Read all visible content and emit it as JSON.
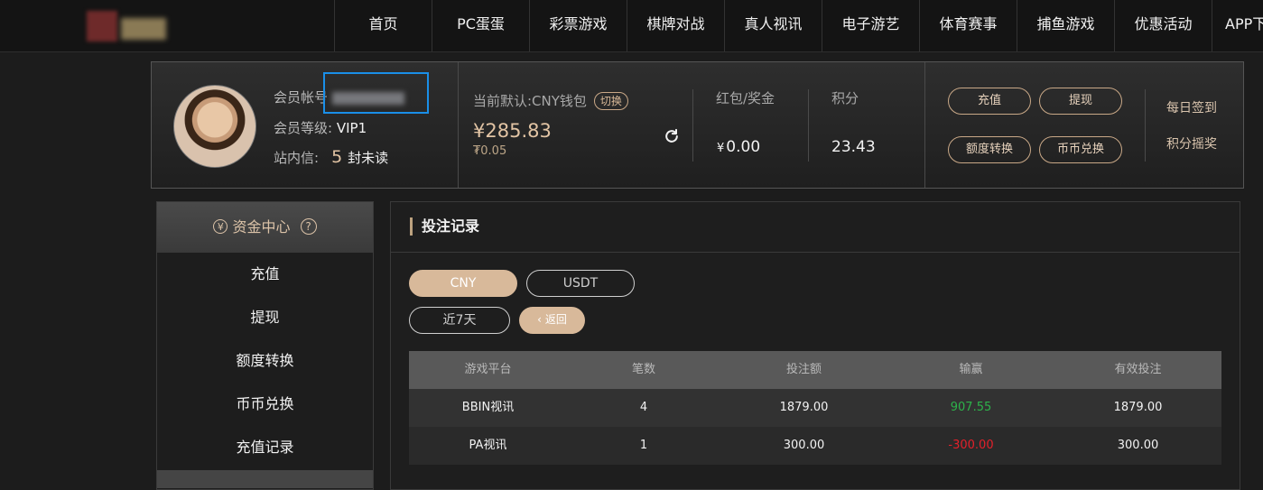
{
  "nav": {
    "items": [
      "首页",
      "PC蛋蛋",
      "彩票游戏",
      "棋牌对战",
      "真人视讯",
      "电子游艺",
      "体育赛事",
      "捕鱼游戏",
      "优惠活动",
      "APP下载"
    ]
  },
  "profile": {
    "account_label": "会员帐号",
    "level_label": "会员等级:",
    "level_value": "VIP1",
    "mail_label": "站内信:",
    "mail_count": "5",
    "mail_unread": "封未读",
    "wallet_label": "当前默认:CNY钱包",
    "switch_label": "切换",
    "balance": "¥285.83",
    "balance_sub": "₮0.05",
    "redpacket_label": "红包/奖金",
    "redpacket_currency": "¥",
    "redpacket_value": "0.00",
    "points_label": "积分",
    "points_value": "23.43",
    "btn_deposit": "充值",
    "btn_withdraw": "提现",
    "btn_transfer": "额度转换",
    "btn_exchange": "币币兑换",
    "daily_signin": "每日签到",
    "points_lottery": "积分摇奖"
  },
  "sidebar": {
    "title": "资金中心",
    "coin_glyph": "¥",
    "help_glyph": "?",
    "items": [
      "充值",
      "提现",
      "额度转换",
      "币币兑换",
      "充值记录"
    ]
  },
  "main": {
    "title": "投注记录",
    "currency_cny": "CNY",
    "currency_usdt": "USDT",
    "period": "近7天",
    "back": "返回",
    "columns": [
      "游戏平台",
      "笔数",
      "投注额",
      "输赢",
      "有效投注"
    ],
    "rows": [
      {
        "platform": "BBIN视讯",
        "count": "4",
        "bet": "1879.00",
        "winloss": "907.55",
        "valid": "1879.00"
      },
      {
        "platform": "PA视讯",
        "count": "1",
        "bet": "300.00",
        "winloss": "-300.00",
        "valid": "300.00"
      }
    ]
  },
  "colors": {
    "accent": "#d8b99a",
    "highlight": "#1a8fe8",
    "win": "#2db34a",
    "loss": "#e3202a"
  }
}
